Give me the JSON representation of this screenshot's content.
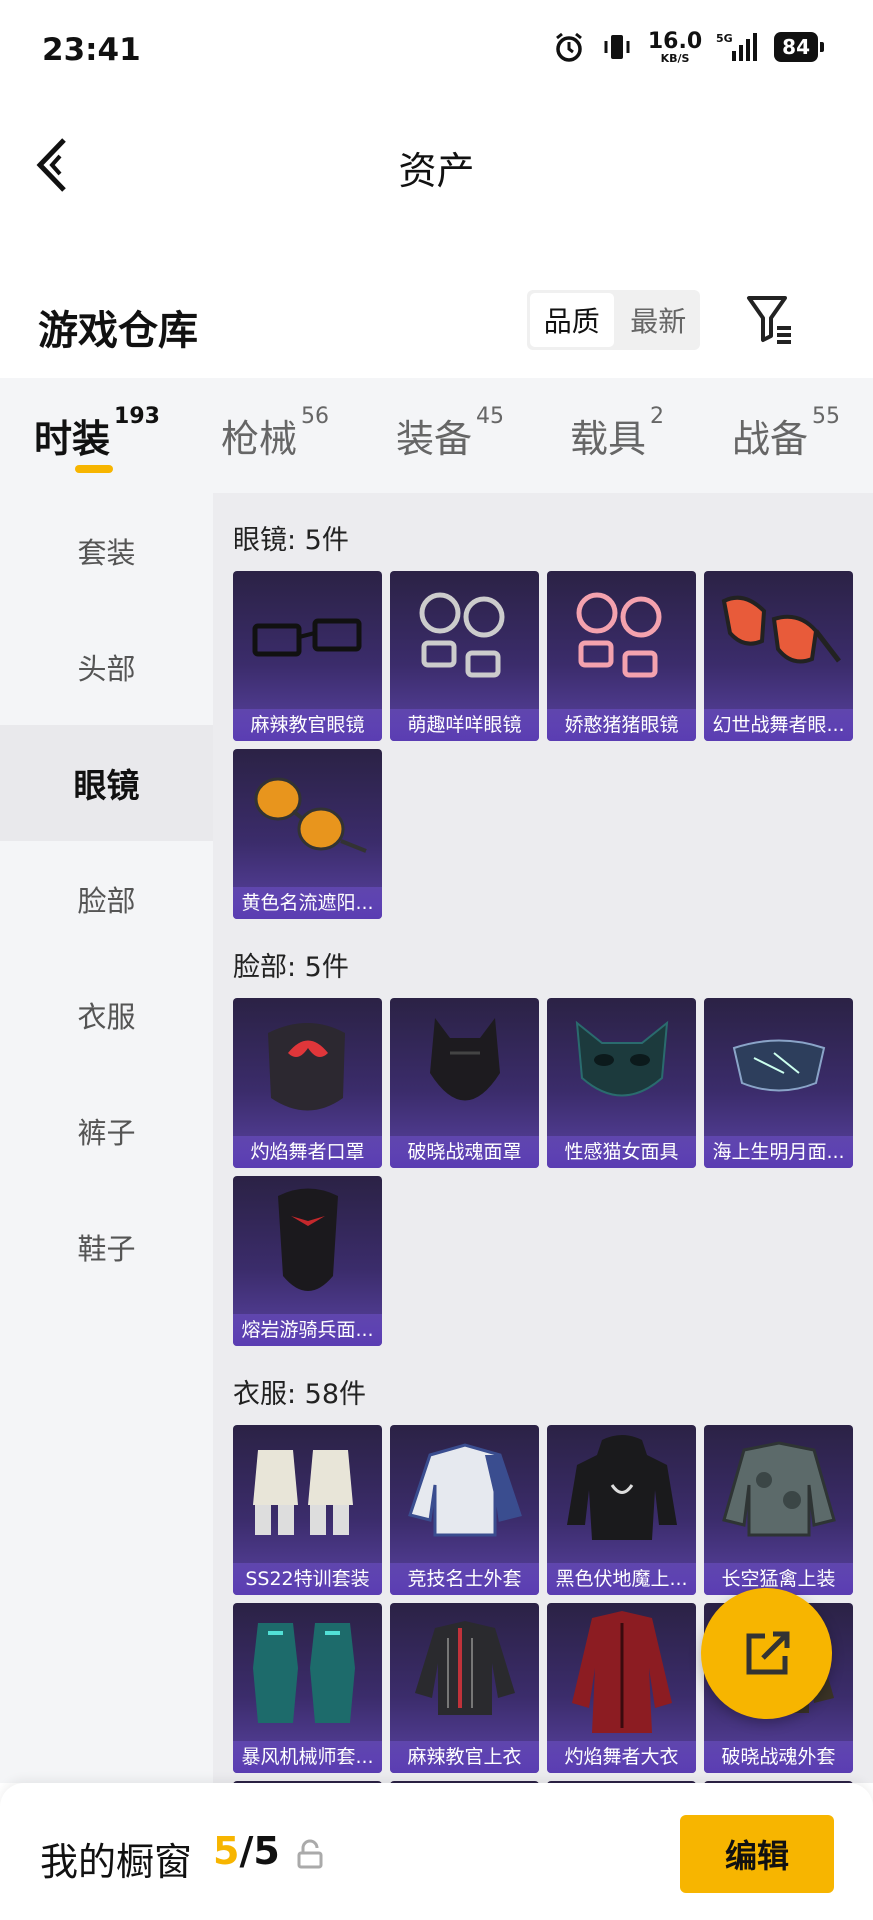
{
  "status_bar": {
    "time": "23:41",
    "speed_value": "16.0",
    "speed_unit": "KB/S",
    "network": "5G",
    "battery": "84"
  },
  "header": {
    "title": "资产",
    "back_icon": "chevron-left-icon"
  },
  "warehouse": {
    "title": "游戏仓库",
    "sort_options": [
      "品质",
      "最新"
    ],
    "active_sort": "品质",
    "filter_icon": "filter-icon"
  },
  "categories": [
    {
      "label": "时装",
      "count": "193"
    },
    {
      "label": "枪械",
      "count": "56"
    },
    {
      "label": "装备",
      "count": "45"
    },
    {
      "label": "载具",
      "count": "2"
    },
    {
      "label": "战备",
      "count": "55"
    }
  ],
  "sidebar": [
    "套装",
    "头部",
    "眼镜",
    "脸部",
    "衣服",
    "裤子",
    "鞋子"
  ],
  "sections": [
    {
      "title": "眼镜: 5件",
      "items": [
        "麻辣教官眼镜",
        "萌趣咩咩眼镜",
        "娇憨猪猪眼镜",
        "幻世战舞者眼...",
        "黄色名流遮阳..."
      ]
    },
    {
      "title": "脸部: 5件",
      "items": [
        "灼焰舞者口罩",
        "破晓战魂面罩",
        "性感猫女面具",
        "海上生明月面...",
        "熔岩游骑兵面..."
      ]
    },
    {
      "title": "衣服: 58件",
      "items": [
        "SS22特训套装",
        "竞技名士外套",
        "黑色伏地魔上...",
        "长空猛禽上装",
        "暴风机械师套...",
        "麻辣教官上衣",
        "灼焰舞者大衣",
        "破晓战魂外套"
      ]
    }
  ],
  "bottom": {
    "shop_label": "我的橱窗",
    "current": "5",
    "separator": "/",
    "total": "5",
    "edit_label": "编辑"
  },
  "colors": {
    "accent": "#f7b500",
    "card_top": "#2b2245",
    "card_bottom": "#5a43a3"
  }
}
